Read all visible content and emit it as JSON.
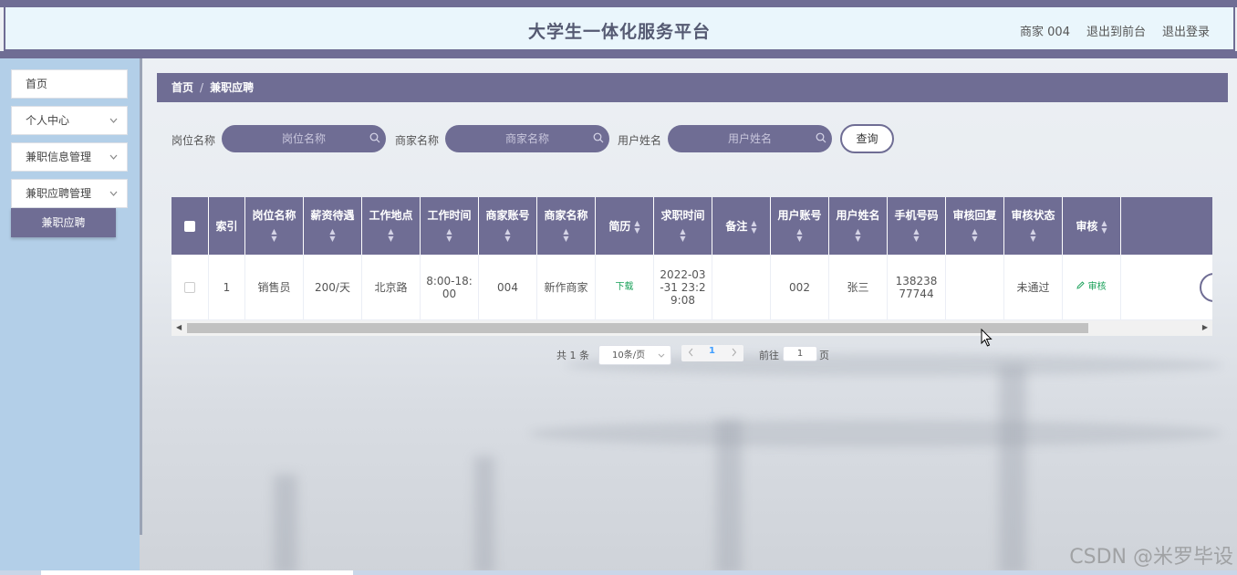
{
  "header": {
    "title": "大学生一体化服务平台",
    "user_label": "商家 004",
    "back_to_front": "退出到前台",
    "logout": "退出登录"
  },
  "sidebar": {
    "items": [
      {
        "label": "首页"
      },
      {
        "label": "个人中心"
      },
      {
        "label": "兼职信息管理"
      },
      {
        "label": "兼职应聘管理"
      }
    ],
    "active_sub": "兼职应聘"
  },
  "breadcrumb": {
    "home": "首页",
    "separator": "/",
    "current": "兼职应聘"
  },
  "search": {
    "job_label": "岗位名称",
    "job_placeholder": "岗位名称",
    "merchant_label": "商家名称",
    "merchant_placeholder": "商家名称",
    "user_label": "用户姓名",
    "user_placeholder": "用户姓名",
    "query_button": "查询"
  },
  "table": {
    "columns": [
      "索引",
      "岗位名称",
      "薪资待遇",
      "工作地点",
      "工作时间",
      "商家账号",
      "商家名称",
      "简历",
      "求职时间",
      "备注",
      "用户账号",
      "用户姓名",
      "手机号码",
      "审核回复",
      "审核状态",
      "审核"
    ],
    "rows": [
      {
        "index": "1",
        "job": "销售员",
        "salary": "200/天",
        "location": "北京路",
        "work_time": "8:00-18:00",
        "merchant_account": "004",
        "merchant_name": "新作商家",
        "resume": "下载",
        "apply_time": "2022-03-31 23:29:08",
        "remark": "",
        "user_account": "002",
        "user_name": "张三",
        "phone": "13823877744",
        "review_reply": "",
        "review_status": "未通过",
        "review_action": "审核"
      }
    ]
  },
  "pagination": {
    "total": "共 1 条",
    "page_size": "10条/页",
    "current_page": "1",
    "goto_label": "前往",
    "goto_value": "1",
    "page_unit": "页"
  },
  "watermark": "CSDN @米罗毕设",
  "colors": {
    "primary": "#6f6d94",
    "sidebar_bg": "#b3cfe8",
    "header_bg": "#eaf6fc",
    "link_green": "#18a058"
  }
}
